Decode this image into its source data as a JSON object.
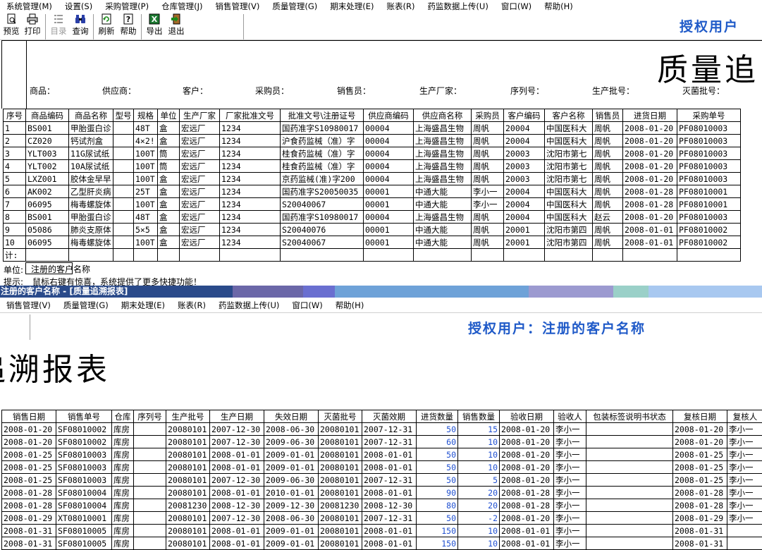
{
  "top_menu": [
    "系统管理(M)",
    "设置(S)",
    "采购管理(P)",
    "仓库管理(J)",
    "销售管理(V)",
    "质量管理(G)",
    "期末处理(E)",
    "账表(R)",
    "药监数据上传(U)",
    "窗口(W)",
    "帮助(H)"
  ],
  "toolbar": {
    "preview": "预览",
    "print": "打印",
    "catalog": "目录",
    "query": "查询",
    "refresh": "刷新",
    "help": "帮助",
    "export": "导出",
    "exit": "退出"
  },
  "auth_top": "授权用户",
  "report": {
    "title_left": "质量追",
    "title_right": "追溯报表",
    "conditions": [
      "商品：",
      "供应商：",
      "客户：",
      "采购员：",
      "销售员：",
      "生产厂家：",
      "序列号：",
      "生产批号：",
      "灭菌批号："
    ],
    "unit_label": "单位:",
    "unit_value": "注册的客户名称",
    "total_label": "计:",
    "hint_label": "提示:",
    "hint_text": "鼠标右键有惊喜，系统提供了更多快捷功能！"
  },
  "left_table": {
    "columns": [
      "序号",
      "商品编码",
      "商品名称",
      "型号",
      "规格",
      "单位",
      "生产厂家",
      "厂家批准文号",
      "批准文号\\注册证号",
      "供应商编码",
      "供应商名称",
      "采购员",
      "客户编码",
      "客户名称",
      "销售员",
      "进货日期",
      "采购单号"
    ],
    "rows": [
      [
        "1",
        "BS001",
        "甲胎蛋白诊",
        "",
        "48T",
        "盒",
        "宏远厂",
        "1234",
        "国药准字S10980017",
        "00004",
        "上海盛昌生物",
        "周帆",
        "20004",
        "中国医科大",
        "周帆",
        "2008-01-20",
        "PF08010003"
      ],
      [
        "2",
        "CZ020",
        "钙试剂盒",
        "",
        "4×2!",
        "盒",
        "宏远厂",
        "1234",
        "沪食药监械（准）字",
        "00004",
        "上海盛昌生物",
        "周帆",
        "20004",
        "中国医科大",
        "周帆",
        "2008-01-20",
        "PF08010003"
      ],
      [
        "3",
        "YLT003",
        "11G尿试纸",
        "",
        "100T",
        "筒",
        "宏远厂",
        "1234",
        "桂食药监械（准）字",
        "00004",
        "上海盛昌生物",
        "周帆",
        "20003",
        "沈阳市第七",
        "周帆",
        "2008-01-20",
        "PF08010003"
      ],
      [
        "4",
        "YLT002",
        "10A尿试纸",
        "",
        "100T",
        "筒",
        "宏远厂",
        "1234",
        "桂食药监械（准）字",
        "00004",
        "上海盛昌生物",
        "周帆",
        "20003",
        "沈阳市第七",
        "周帆",
        "2008-01-20",
        "PF08010003"
      ],
      [
        "5",
        "LXZ001",
        "胶体金早早",
        "",
        "100T",
        "盒",
        "宏远厂",
        "1234",
        "京药监械(准)字200",
        "00004",
        "上海盛昌生物",
        "周帆",
        "20003",
        "沈阳市第七",
        "周帆",
        "2008-01-20",
        "PF08010003"
      ],
      [
        "6",
        "AK002",
        "乙型肝炎病",
        "",
        "25T",
        "盒",
        "宏远厂",
        "1234",
        "国药准字S20050035",
        "00001",
        "中通大能",
        "李小一",
        "20004",
        "中国医科大",
        "周帆",
        "2008-01-28",
        "PF08010001"
      ],
      [
        "7",
        "06095",
        "梅毒螺旋体",
        "",
        "100T",
        "盒",
        "宏远厂",
        "1234",
        "S20040067",
        "00001",
        "中通大能",
        "李小一",
        "20004",
        "中国医科大",
        "周帆",
        "2008-01-28",
        "PF08010001"
      ],
      [
        "8",
        "BS001",
        "甲胎蛋白诊",
        "",
        "48T",
        "盒",
        "宏远厂",
        "1234",
        "国药准字S10980017",
        "00004",
        "上海盛昌生物",
        "周帆",
        "20004",
        "中国医科大",
        "赵云",
        "2008-01-20",
        "PF08010003"
      ],
      [
        "9",
        "05086",
        "肺炎支原体",
        "",
        "5×5",
        "盒",
        "宏远厂",
        "1234",
        "S20040076",
        "00001",
        "中通大能",
        "周帆",
        "20001",
        "沈阳市第四",
        "周帆",
        "2008-01-01",
        "PF08010002"
      ],
      [
        "10",
        "06095",
        "梅毒螺旋体",
        "",
        "100T",
        "盒",
        "宏远厂",
        "1234",
        "S20040067",
        "00001",
        "中通大能",
        "周帆",
        "20001",
        "沈阳市第四",
        "周帆",
        "2008-01-01",
        "PF08010002"
      ]
    ]
  },
  "window_title": "注册的客户名称 - [质量追溯报表]",
  "second_menu": [
    "销售管理(V)",
    "质量管理(G)",
    "期末处理(E)",
    "账表(R)",
    "药监数据上传(U)",
    "窗口(W)",
    "帮助(H)"
  ],
  "auth_bottom": "授权用户：注册的客户名称",
  "right_table": {
    "columns": [
      "销售日期",
      "销售单号",
      "仓库",
      "序列号",
      "生产批号",
      "生产日期",
      "失效日期",
      "灭菌批号",
      "灭菌效期",
      "进货数量",
      "销售数量",
      "验收日期",
      "验收人",
      "包装标签说明书状态",
      "复核日期",
      "复核人"
    ],
    "rows": [
      [
        "2008-01-20",
        "SF08010002",
        "库房",
        "",
        "20080101",
        "2007-12-30",
        "2008-06-30",
        "20080101",
        "2007-12-31",
        "50",
        "15",
        "2008-01-20",
        "李小一",
        "",
        "2008-01-20",
        "李小一"
      ],
      [
        "2008-01-20",
        "SF08010002",
        "库房",
        "",
        "20080101",
        "2007-12-30",
        "2009-06-30",
        "20080101",
        "2007-12-31",
        "60",
        "10",
        "2008-01-20",
        "李小一",
        "",
        "2008-01-20",
        "李小一"
      ],
      [
        "2008-01-25",
        "SF08010003",
        "库房",
        "",
        "20080101",
        "2008-01-01",
        "2009-01-01",
        "20080101",
        "2008-01-01",
        "50",
        "10",
        "2008-01-20",
        "李小一",
        "",
        "2008-01-25",
        "李小一"
      ],
      [
        "2008-01-25",
        "SF08010003",
        "库房",
        "",
        "20080101",
        "2008-01-01",
        "2009-01-01",
        "20080101",
        "2008-01-01",
        "50",
        "10",
        "2008-01-20",
        "李小一",
        "",
        "2008-01-25",
        "李小一"
      ],
      [
        "2008-01-25",
        "SF08010003",
        "库房",
        "",
        "20080101",
        "2007-12-30",
        "2009-06-30",
        "20080101",
        "2007-12-31",
        "50",
        "5",
        "2008-01-20",
        "李小一",
        "",
        "2008-01-25",
        "李小一"
      ],
      [
        "2008-01-28",
        "SF08010004",
        "库房",
        "",
        "20080101",
        "2008-01-01",
        "2010-01-01",
        "20080101",
        "2008-01-01",
        "90",
        "20",
        "2008-01-28",
        "李小一",
        "",
        "2008-01-28",
        "李小一"
      ],
      [
        "2008-01-28",
        "SF08010004",
        "库房",
        "",
        "20081230",
        "2008-12-30",
        "2009-12-30",
        "20081230",
        "2008-12-30",
        "80",
        "20",
        "2008-01-28",
        "李小一",
        "",
        "2008-01-28",
        "李小一"
      ],
      [
        "2008-01-29",
        "XT08010001",
        "库房",
        "",
        "20080101",
        "2007-12-30",
        "2008-06-30",
        "20080101",
        "2007-12-31",
        "50",
        "-2",
        "2008-01-20",
        "李小一",
        "",
        "2008-01-29",
        "李小一"
      ],
      [
        "2008-01-31",
        "SF08010005",
        "库房",
        "",
        "20080101",
        "2008-01-01",
        "2009-01-01",
        "20080101",
        "2008-01-01",
        "150",
        "10",
        "2008-01-01",
        "李小一",
        "",
        "2008-01-31",
        ""
      ],
      [
        "2008-01-31",
        "SF08010005",
        "库房",
        "",
        "20080101",
        "2008-01-01",
        "2009-01-01",
        "20080101",
        "2008-01-01",
        "150",
        "10",
        "2008-01-01",
        "李小一",
        "",
        "2008-01-31",
        ""
      ]
    ]
  },
  "colors": {
    "auth_blue": "#1f5ac8",
    "title_bar_dark": "#16367a",
    "number_blue": "#1f4fd0"
  }
}
